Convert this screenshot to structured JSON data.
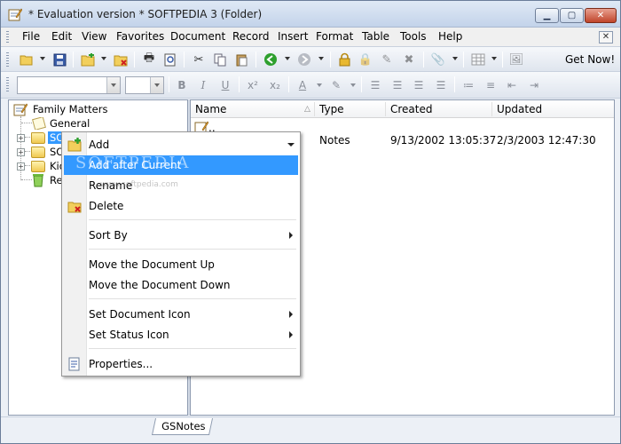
{
  "window": {
    "title": "* Evaluation version * SOFTPEDIA 3 (Folder)",
    "accent": "#3399ff"
  },
  "menubar": {
    "items": [
      "File",
      "Edit",
      "View",
      "Favorites",
      "Document",
      "Record",
      "Insert",
      "Format",
      "Table",
      "Tools",
      "Help"
    ],
    "close_glyph": "✕"
  },
  "toolbar": {
    "get_now_label": "Get Now!"
  },
  "tree": {
    "root": "Family Matters",
    "items": [
      {
        "label": "General"
      },
      {
        "label": "SO"
      },
      {
        "label": "SO"
      },
      {
        "label": "Kid"
      },
      {
        "label": "Re"
      }
    ]
  },
  "list": {
    "columns": [
      "Name",
      "Type",
      "Created",
      "Updated"
    ],
    "rows": [
      {
        "name": "..",
        "type": "Notes",
        "created": "9/13/2002 13:05:37",
        "updated": "2/3/2003 12:47:30"
      }
    ]
  },
  "status": {
    "tab_label": "GSNotes"
  },
  "context_menu": {
    "items": [
      {
        "label": "Add",
        "icon": "add-note-icon"
      },
      {
        "label": "Add after Current"
      },
      {
        "label": "Rename"
      },
      {
        "label": "Delete",
        "icon": "delete-note-icon"
      },
      {
        "label": "Sort By"
      },
      {
        "label": "Move the Document Up"
      },
      {
        "label": "Move the Document Down"
      },
      {
        "label": "Set Document Icon"
      },
      {
        "label": "Set Status Icon"
      },
      {
        "label": "Properties...",
        "icon": "properties-icon"
      }
    ]
  },
  "watermark": {
    "text": "SOFTPEDIA",
    "small": "www.softpedia.com"
  }
}
